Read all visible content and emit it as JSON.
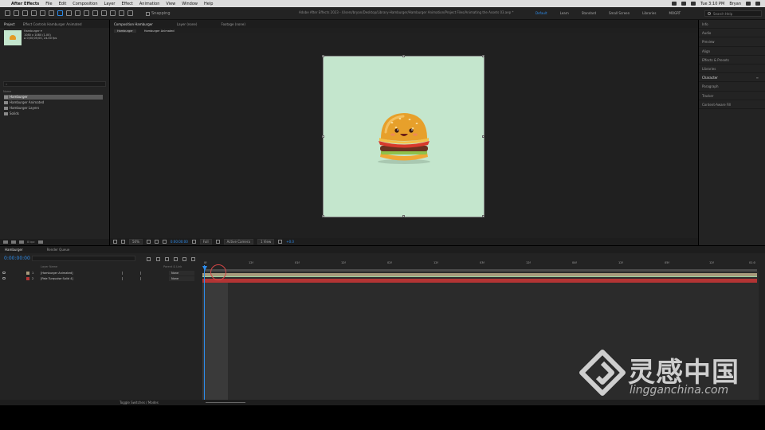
{
  "menubar": {
    "app_name": "After Effects",
    "items": [
      "File",
      "Edit",
      "Composition",
      "Layer",
      "Effect",
      "Animation",
      "View",
      "Window",
      "Help"
    ],
    "clock": "Tue 3:10 PM",
    "user": "Bryan"
  },
  "toolbar": {
    "snapping_label": "Snapping",
    "doc_title": "Adobe After Effects 2023 - /Users/bryan/Desktop/Library-Hamburger/Hamburger Animation/Project Files/Animating the Assets 03.aep *",
    "workspaces": [
      "Default",
      "Learn",
      "Standard",
      "Small Screen",
      "Libraries",
      "MOGRT"
    ],
    "active_workspace": "Default",
    "search_placeholder": "Search Help"
  },
  "project": {
    "tabs": [
      "Project",
      "Effect Controls Hamburger Animated"
    ],
    "selected_name": "Hamburger ▾",
    "info_line1": "1080 x 1080 (1.00)",
    "info_line2": "Δ 0;00;05;00, 24.00 fps",
    "search_placeholder": "⌕",
    "col_name": "Name",
    "items": [
      {
        "name": "Hamburger",
        "selected": true
      },
      {
        "name": "Hamburger Animated",
        "selected": false
      },
      {
        "name": "Hamburger Layers",
        "selected": false
      },
      {
        "name": "Solids",
        "selected": false
      }
    ],
    "bpc": "8 bpc"
  },
  "viewer": {
    "tabs": [
      "Composition Hamburger",
      "Layer (none)",
      "Footage (none)"
    ],
    "crumbs": [
      "Hamburger",
      "Hamburger Animated"
    ],
    "zoom": "50%",
    "timecode": "0:00:00:00",
    "resolution": "Full",
    "camera": "Active Camera",
    "views": "1 View",
    "exposure": "+0.0",
    "comp_bg": "#c4e6cd"
  },
  "right_panels": [
    {
      "label": "Info",
      "active": false
    },
    {
      "label": "Audio",
      "active": false
    },
    {
      "label": "Preview",
      "active": false
    },
    {
      "label": "Align",
      "active": false
    },
    {
      "label": "Effects & Presets",
      "active": false
    },
    {
      "label": "Libraries",
      "active": false
    },
    {
      "label": "Character",
      "active": true
    },
    {
      "label": "Paragraph",
      "active": false
    },
    {
      "label": "Tracker",
      "active": false
    },
    {
      "label": "Content-Aware Fill",
      "active": false
    }
  ],
  "timeline": {
    "tabs": [
      "Hamburger",
      "Render Queue"
    ],
    "timecode": "0:00:00:00",
    "col_source": "Layer Name",
    "col_parent": "Parent & Link",
    "layers": [
      {
        "num": "1",
        "name": "[Hamburger Animated]",
        "parent": "None",
        "color": "#a79a7c"
      },
      {
        "num": "2",
        "name": "[Pale Turquoise Solid 4]",
        "parent": "None",
        "color": "#b33434"
      }
    ],
    "ruler_ticks": [
      "0f",
      "12f",
      "01f",
      "12f",
      "02f",
      "12f",
      "03f",
      "12f",
      "04f",
      "12f",
      "05f",
      "12f",
      "01:0"
    ],
    "toggle_label": "Toggle Switches / Modes"
  },
  "watermark": {
    "cn": "灵感中国",
    "en": "lingganchina.com"
  },
  "colors": {
    "accent": "#2d8ceb",
    "panel": "#232323",
    "burger_bun": "#e39a25"
  }
}
